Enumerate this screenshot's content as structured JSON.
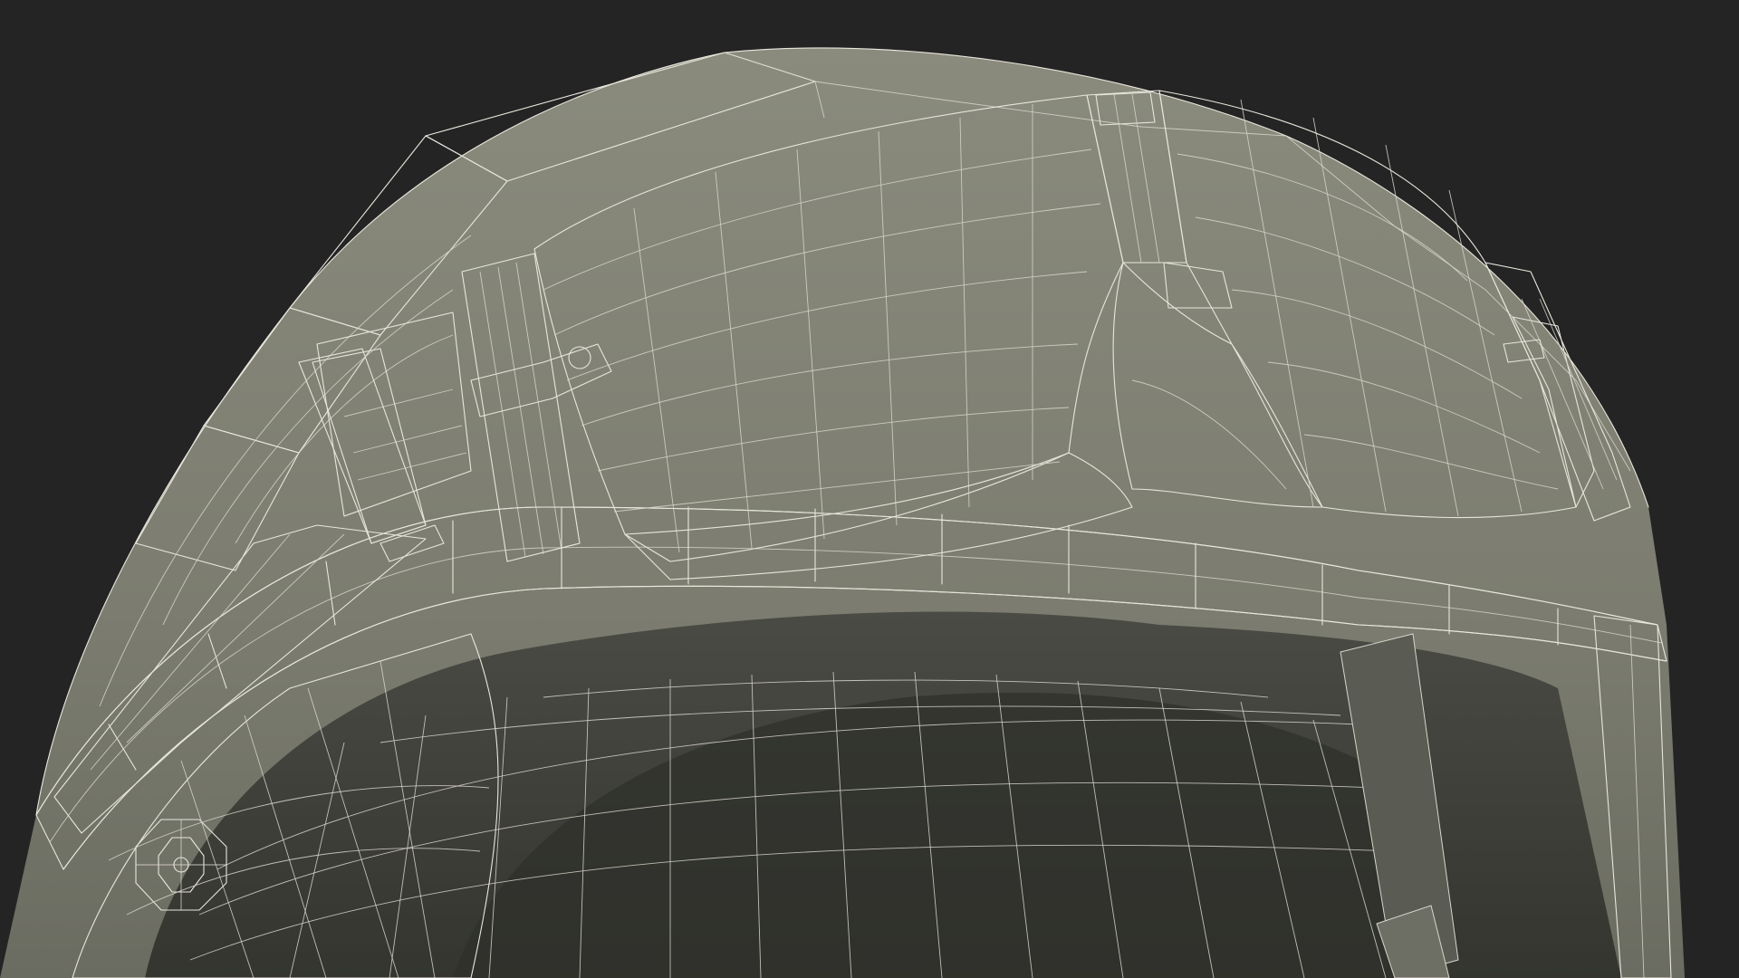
{
  "scene": {
    "subject": "helmet-wireframe-render",
    "colors": {
      "background": "#242424",
      "shell_light": "#858677",
      "shell_mid": "#75766a",
      "shell_dark": "#5f6056",
      "interior_dark": "#3e3f39",
      "interior_mid": "#4f5048",
      "wire": "#e8e6dc"
    }
  }
}
